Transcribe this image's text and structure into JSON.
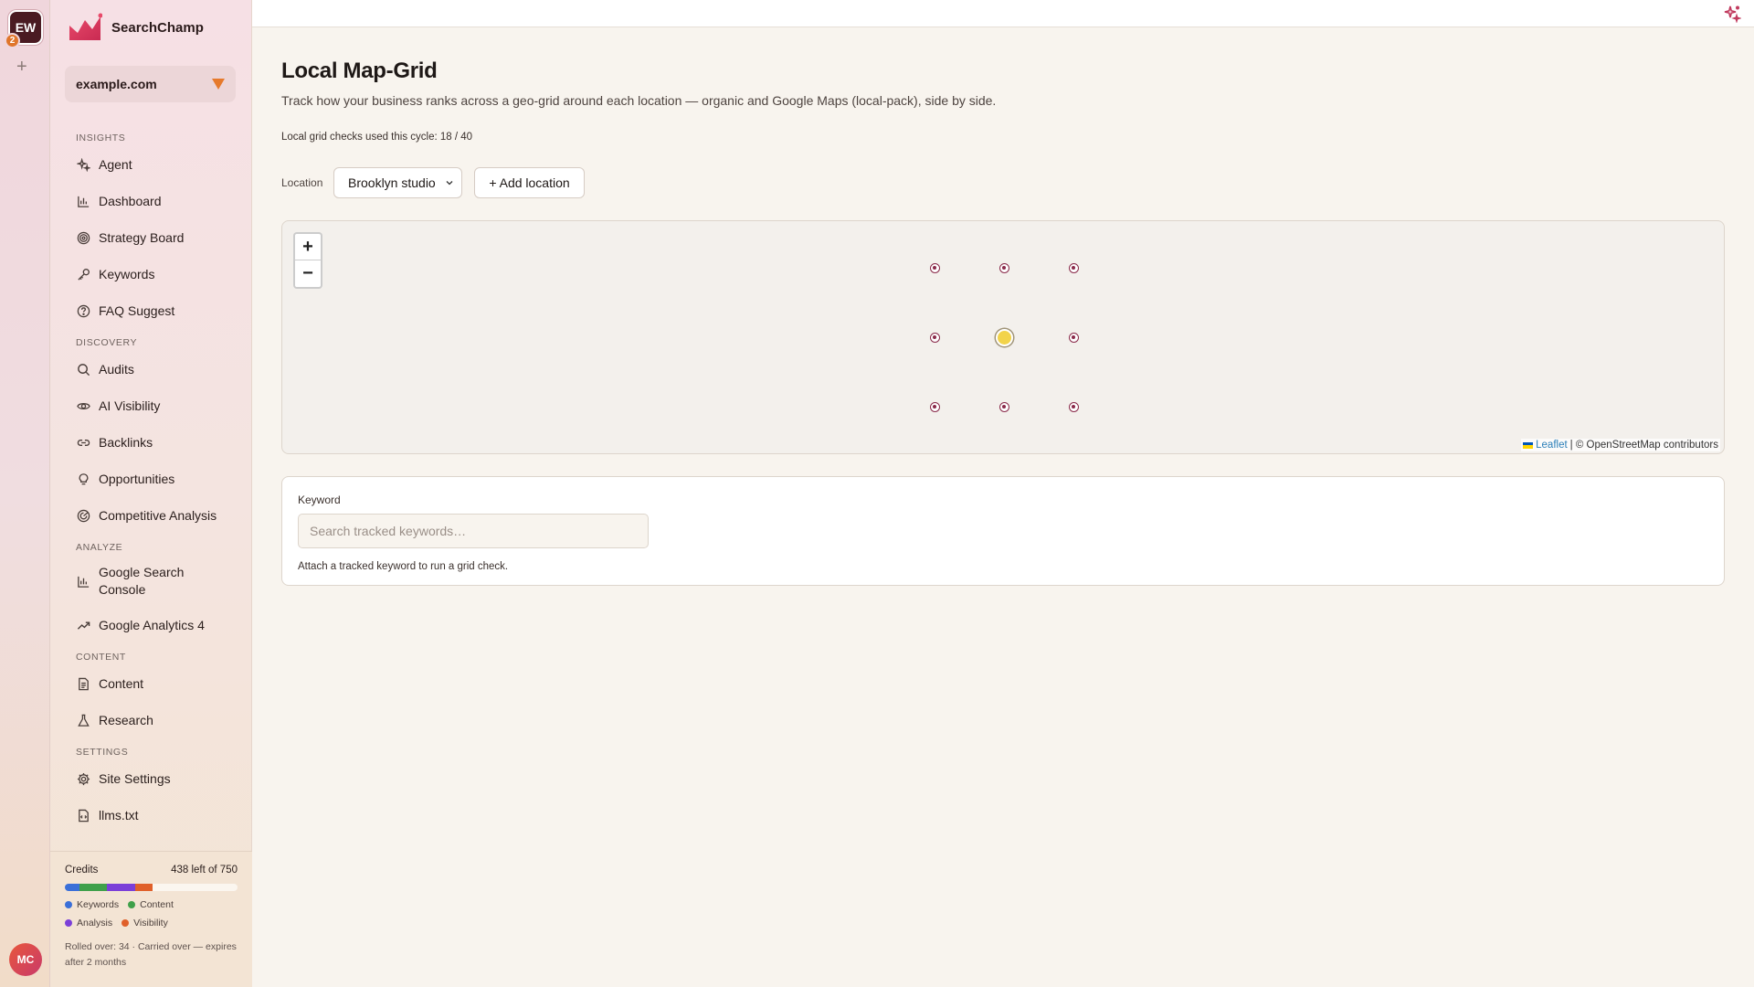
{
  "workspace": {
    "initials": "EW",
    "badge_count": "2",
    "add_label": "+",
    "user_initials": "MC"
  },
  "brand": {
    "name": "SearchChamp",
    "accent": "#d9365e"
  },
  "site_selector": {
    "value": "example.com",
    "caret_color": "#e67a2c"
  },
  "nav": {
    "insights": {
      "title": "INSIGHTS",
      "items": [
        {
          "label": "Agent",
          "icon": "sparkle-icon"
        },
        {
          "label": "Dashboard",
          "icon": "bar-chart-icon"
        },
        {
          "label": "Strategy Board",
          "icon": "target-icon"
        },
        {
          "label": "Keywords",
          "icon": "key-icon"
        },
        {
          "label": "FAQ Suggest",
          "icon": "help-circle-icon"
        }
      ]
    },
    "discovery": {
      "title": "DISCOVERY",
      "items": [
        {
          "label": "Audits",
          "icon": "search-icon"
        },
        {
          "label": "AI Visibility",
          "icon": "eye-icon"
        },
        {
          "label": "Backlinks",
          "icon": "link-icon"
        },
        {
          "label": "Opportunities",
          "icon": "lightbulb-icon"
        },
        {
          "label": "Competitive Analysis",
          "icon": "radar-icon"
        }
      ]
    },
    "analyze": {
      "title": "ANALYZE",
      "items": [
        {
          "label": "Google Search Console",
          "icon": "bar-chart-icon"
        },
        {
          "label": "Google Analytics 4",
          "icon": "trending-up-icon"
        }
      ]
    },
    "content": {
      "title": "CONTENT",
      "items": [
        {
          "label": "Content",
          "icon": "document-icon"
        },
        {
          "label": "Research",
          "icon": "flask-icon"
        }
      ]
    },
    "settings": {
      "title": "SETTINGS",
      "items": [
        {
          "label": "Site Settings",
          "icon": "gear-icon"
        },
        {
          "label": "llms.txt",
          "icon": "file-code-icon"
        }
      ]
    }
  },
  "credits": {
    "label": "Credits",
    "summary": "438 left of 750",
    "used": 312,
    "total": 750,
    "segments": [
      {
        "name": "Keywords",
        "value": 64,
        "color": "#3a6fd8"
      },
      {
        "name": "Content",
        "value": 118,
        "color": "#3fa04a"
      },
      {
        "name": "Analysis",
        "value": 124,
        "color": "#7b3fd8"
      },
      {
        "name": "Visibility",
        "value": 76,
        "color": "#e0602a"
      }
    ],
    "rolled_text": "Rolled over: 34 · Carried over — expires after 2 months"
  },
  "page": {
    "title": "Local Map-Grid",
    "subtitle": "Track how your business ranks across a geo-grid around each location — organic and Google Maps (local-pack), side by side.",
    "usage": "Local grid checks used this cycle: 18 / 40"
  },
  "location": {
    "label": "Location",
    "selected": "Brooklyn studio",
    "add_label": "+ Add location"
  },
  "map": {
    "zoom_in": "+",
    "zoom_out": "−",
    "grid_size": "3x3",
    "attribution_link": "Leaflet",
    "attribution_text": "| © OpenStreetMap contributors",
    "pin_color": "#8a2a4a",
    "center_color": "#f2d34a"
  },
  "keyword": {
    "label": "Keyword",
    "placeholder": "Search tracked keywords…",
    "value": "",
    "help": "Attach a tracked keyword to run a grid check."
  }
}
